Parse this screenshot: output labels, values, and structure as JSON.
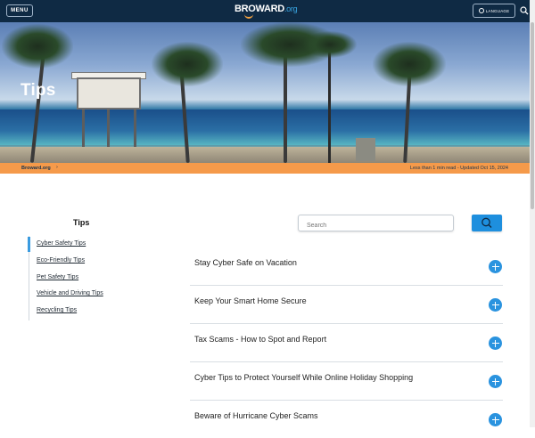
{
  "header": {
    "menu_label": "MENU",
    "logo_part1": "BRO",
    "logo_part2": "WARD",
    "logo_part3": ".org",
    "language_label": "LANGUAGE",
    "globe_icon": "globe-icon",
    "search_icon": "search-icon"
  },
  "hero": {
    "title": "Tips"
  },
  "infobar": {
    "breadcrumb": "Broward.org",
    "breadcrumb_separator": "›",
    "read_time": "Less than 1 min read - Updated Oct 15, 2024"
  },
  "sidebar": {
    "title": "Tips",
    "items": [
      {
        "label": "Cyber Safety Tips",
        "active": true
      },
      {
        "label": "Eco-Friendly Tips",
        "active": false
      },
      {
        "label": "Pet Safety Tips",
        "active": false
      },
      {
        "label": "Vehicle and Driving Tips",
        "active": false
      },
      {
        "label": "Recycling Tips",
        "active": false
      }
    ]
  },
  "search": {
    "placeholder": "Search",
    "button_icon": "search-icon"
  },
  "accordion": {
    "items": [
      {
        "label": "Stay Cyber Safe on Vacation",
        "icon": "plus-icon"
      },
      {
        "label": "Keep Your Smart Home Secure",
        "icon": "plus-icon"
      },
      {
        "label": "Tax Scams - How to Spot and Report",
        "icon": "plus-icon"
      },
      {
        "label": "Cyber Tips to Protect Yourself While Online Holiday Shopping",
        "icon": "plus-icon"
      },
      {
        "label": "Beware of Hurricane Cyber Scams",
        "icon": "plus-icon"
      }
    ]
  },
  "colors": {
    "header_bg": "#0f2a44",
    "accent_orange": "#f59a4a",
    "accent_blue": "#1e8fde"
  }
}
